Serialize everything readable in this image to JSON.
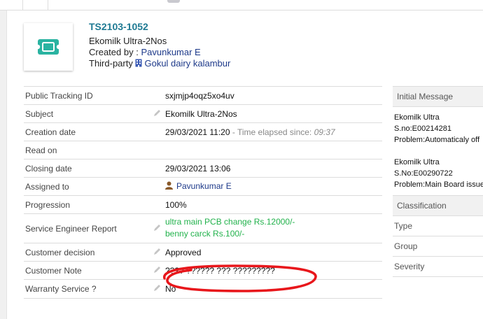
{
  "ticket": {
    "ref": "TS2103-1052",
    "subject": "Ekomilk Ultra-2Nos",
    "created_by_label": "Created by :",
    "created_by": "Pavunkumar E",
    "third_party_label": "Third-party",
    "third_party": "Gokul dairy kalambur"
  },
  "fields": {
    "tracking": {
      "label": "Public Tracking ID",
      "value": "sxjmjp4oqz5xo4uv"
    },
    "subject": {
      "label": "Subject",
      "value": "Ekomilk Ultra-2Nos"
    },
    "creation": {
      "label": "Creation date",
      "value": "29/03/2021 11:20",
      "elapsed_label": " - Time elapsed since: ",
      "elapsed": "09:37"
    },
    "read_on": {
      "label": "Read on",
      "value": ""
    },
    "closing": {
      "label": "Closing date",
      "value": "29/03/2021 13:06"
    },
    "assigned": {
      "label": "Assigned to",
      "value": "Pavunkumar E"
    },
    "progression": {
      "label": "Progression",
      "value": "100%"
    },
    "engineer_report": {
      "label": "Service Engineer Report",
      "line1": "ultra main PCB change Rs.12000/-",
      "line2": "benny carck Rs.100/-"
    },
    "customer_decision": {
      "label": "Customer decision",
      "value": "Approved"
    },
    "customer_note": {
      "label": "Customer Note",
      "value": "???? ?????? ??? ?????????"
    },
    "warranty": {
      "label": "Warranty Service ?",
      "value": "No"
    }
  },
  "side": {
    "initial_header": "Initial Message",
    "msg1": [
      "Ekomilk Ultra",
      "S.no:E00214281",
      "Problem:Automaticaly off"
    ],
    "msg2": [
      "Ekomilk Ultra",
      "S.No:E00290722",
      "Problem:Main Board issue"
    ],
    "classification_header": "Classification",
    "items": [
      "Type",
      "Group",
      "Severity"
    ]
  },
  "colors": {
    "accent": "#1f7a93",
    "link": "#1e3a8a",
    "green": "#22b24c",
    "annotation_red": "#e8161b",
    "logo_teal": "#2ab3a1"
  }
}
